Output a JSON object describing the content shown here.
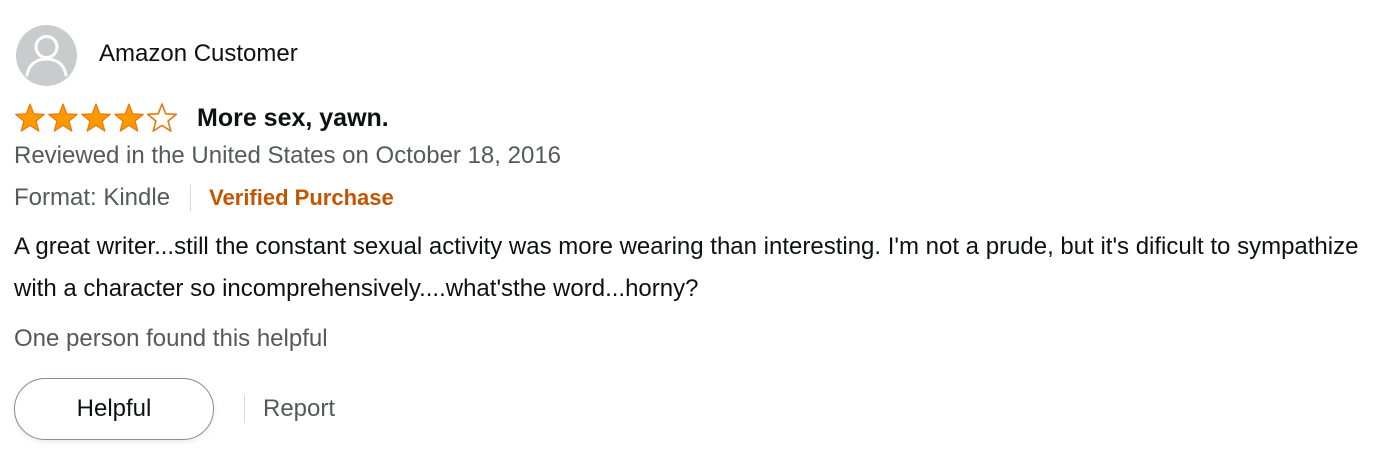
{
  "review": {
    "author_name": "Amazon Customer",
    "rating": 4,
    "rating_max": 5,
    "title": "More sex, yawn.",
    "date_line": "Reviewed in the United States on October 18, 2016",
    "format": "Format: Kindle",
    "verified_label": "Verified Purchase",
    "body": "A great writer...still the constant sexual activity was more wearing than interesting. I'm not a prude, but it's dificult to sympathize with a character so incomprehensively....what'sthe word...horny?",
    "helpful_count_text": "One person found this helpful"
  },
  "actions": {
    "helpful_label": "Helpful",
    "report_label": "Report"
  },
  "colors": {
    "star_fill": "#ff9900",
    "star_stroke": "#e47911",
    "verified": "#c45500",
    "secondary_text": "#565959",
    "avatar_bg": "#c8cccc"
  },
  "icons": {
    "avatar": "default-user-avatar-icon",
    "star_full": "star-filled-icon",
    "star_empty": "star-empty-icon"
  }
}
